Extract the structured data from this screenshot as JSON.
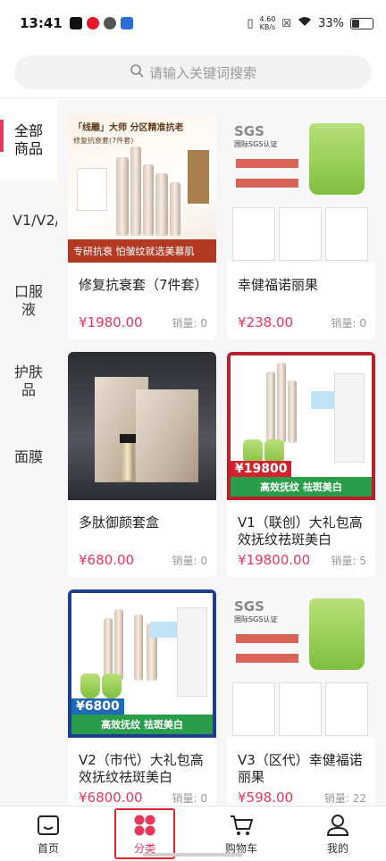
{
  "status_bar": {
    "time": "13:41",
    "net_speed": "4.60",
    "net_unit": "KB/s",
    "battery": "33%"
  },
  "search": {
    "placeholder": "请输入关键词搜索"
  },
  "sidebar": {
    "items": [
      {
        "label": "全部商品",
        "active": true
      },
      {
        "label": "V1/V2/",
        "active": false
      },
      {
        "label": "口服液",
        "active": false
      },
      {
        "label": "护肤品",
        "active": false
      },
      {
        "label": "面膜",
        "active": false
      }
    ]
  },
  "sales_label": "销量:",
  "products": [
    {
      "name": "修复抗衰套（7件套）",
      "price": "¥1980.00",
      "sales": "0",
      "thumb": {
        "head": "「线雕」大师 分区精准抗老",
        "sub": "修复抗衰套(7件套)",
        "banner": "专研抗衰  怕皱纹就选美慕肌"
      }
    },
    {
      "name": "幸健福诺丽果",
      "price": "¥238.00",
      "sales": "0",
      "thumb": {
        "head": "SGS",
        "sub": "国际SGS认证"
      }
    },
    {
      "name": "多肽御颜套盒",
      "price": "¥680.00",
      "sales": "0",
      "thumb": {}
    },
    {
      "name": "V1（联创）大礼包高效抚纹祛斑美白",
      "price": "¥19800.00",
      "sales": "5",
      "thumb": {
        "tag": "¥19800",
        "ribbon": "高效抚纹 祛斑美白"
      }
    },
    {
      "name": "V2（市代）大礼包高效抚纹祛斑美白",
      "price": "¥6800.00",
      "sales": "0",
      "thumb": {
        "tag": "¥6800",
        "ribbon": "高效抚纹 祛斑美白"
      }
    },
    {
      "name": "V3（区代）幸健福诺丽果",
      "price": "¥598.00",
      "sales": "22",
      "thumb": {
        "head": "SGS",
        "sub": "国际SGS认证"
      }
    }
  ],
  "tabbar": {
    "items": [
      {
        "label": "首页",
        "icon": "home-icon"
      },
      {
        "label": "分类",
        "icon": "category-icon",
        "active": true
      },
      {
        "label": "购物车",
        "icon": "cart-icon"
      },
      {
        "label": "我的",
        "icon": "profile-icon"
      }
    ]
  },
  "colors": {
    "accent": "#e8365d",
    "highlight_border": "#e8202b"
  }
}
